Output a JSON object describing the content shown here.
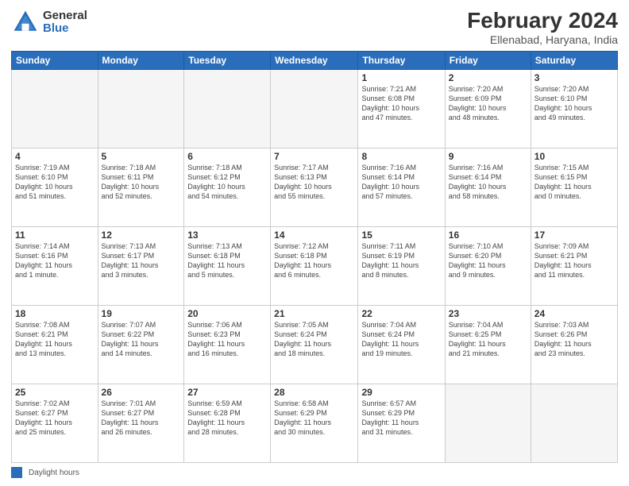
{
  "header": {
    "logo_general": "General",
    "logo_blue": "Blue",
    "main_title": "February 2024",
    "subtitle": "Ellenabad, Haryana, India"
  },
  "days_of_week": [
    "Sunday",
    "Monday",
    "Tuesday",
    "Wednesday",
    "Thursday",
    "Friday",
    "Saturday"
  ],
  "weeks": [
    [
      {
        "day": "",
        "info": ""
      },
      {
        "day": "",
        "info": ""
      },
      {
        "day": "",
        "info": ""
      },
      {
        "day": "",
        "info": ""
      },
      {
        "day": "1",
        "info": "Sunrise: 7:21 AM\nSunset: 6:08 PM\nDaylight: 10 hours\nand 47 minutes."
      },
      {
        "day": "2",
        "info": "Sunrise: 7:20 AM\nSunset: 6:09 PM\nDaylight: 10 hours\nand 48 minutes."
      },
      {
        "day": "3",
        "info": "Sunrise: 7:20 AM\nSunset: 6:10 PM\nDaylight: 10 hours\nand 49 minutes."
      }
    ],
    [
      {
        "day": "4",
        "info": "Sunrise: 7:19 AM\nSunset: 6:10 PM\nDaylight: 10 hours\nand 51 minutes."
      },
      {
        "day": "5",
        "info": "Sunrise: 7:18 AM\nSunset: 6:11 PM\nDaylight: 10 hours\nand 52 minutes."
      },
      {
        "day": "6",
        "info": "Sunrise: 7:18 AM\nSunset: 6:12 PM\nDaylight: 10 hours\nand 54 minutes."
      },
      {
        "day": "7",
        "info": "Sunrise: 7:17 AM\nSunset: 6:13 PM\nDaylight: 10 hours\nand 55 minutes."
      },
      {
        "day": "8",
        "info": "Sunrise: 7:16 AM\nSunset: 6:14 PM\nDaylight: 10 hours\nand 57 minutes."
      },
      {
        "day": "9",
        "info": "Sunrise: 7:16 AM\nSunset: 6:14 PM\nDaylight: 10 hours\nand 58 minutes."
      },
      {
        "day": "10",
        "info": "Sunrise: 7:15 AM\nSunset: 6:15 PM\nDaylight: 11 hours\nand 0 minutes."
      }
    ],
    [
      {
        "day": "11",
        "info": "Sunrise: 7:14 AM\nSunset: 6:16 PM\nDaylight: 11 hours\nand 1 minute."
      },
      {
        "day": "12",
        "info": "Sunrise: 7:13 AM\nSunset: 6:17 PM\nDaylight: 11 hours\nand 3 minutes."
      },
      {
        "day": "13",
        "info": "Sunrise: 7:13 AM\nSunset: 6:18 PM\nDaylight: 11 hours\nand 5 minutes."
      },
      {
        "day": "14",
        "info": "Sunrise: 7:12 AM\nSunset: 6:18 PM\nDaylight: 11 hours\nand 6 minutes."
      },
      {
        "day": "15",
        "info": "Sunrise: 7:11 AM\nSunset: 6:19 PM\nDaylight: 11 hours\nand 8 minutes."
      },
      {
        "day": "16",
        "info": "Sunrise: 7:10 AM\nSunset: 6:20 PM\nDaylight: 11 hours\nand 9 minutes."
      },
      {
        "day": "17",
        "info": "Sunrise: 7:09 AM\nSunset: 6:21 PM\nDaylight: 11 hours\nand 11 minutes."
      }
    ],
    [
      {
        "day": "18",
        "info": "Sunrise: 7:08 AM\nSunset: 6:21 PM\nDaylight: 11 hours\nand 13 minutes."
      },
      {
        "day": "19",
        "info": "Sunrise: 7:07 AM\nSunset: 6:22 PM\nDaylight: 11 hours\nand 14 minutes."
      },
      {
        "day": "20",
        "info": "Sunrise: 7:06 AM\nSunset: 6:23 PM\nDaylight: 11 hours\nand 16 minutes."
      },
      {
        "day": "21",
        "info": "Sunrise: 7:05 AM\nSunset: 6:24 PM\nDaylight: 11 hours\nand 18 minutes."
      },
      {
        "day": "22",
        "info": "Sunrise: 7:04 AM\nSunset: 6:24 PM\nDaylight: 11 hours\nand 19 minutes."
      },
      {
        "day": "23",
        "info": "Sunrise: 7:04 AM\nSunset: 6:25 PM\nDaylight: 11 hours\nand 21 minutes."
      },
      {
        "day": "24",
        "info": "Sunrise: 7:03 AM\nSunset: 6:26 PM\nDaylight: 11 hours\nand 23 minutes."
      }
    ],
    [
      {
        "day": "25",
        "info": "Sunrise: 7:02 AM\nSunset: 6:27 PM\nDaylight: 11 hours\nand 25 minutes."
      },
      {
        "day": "26",
        "info": "Sunrise: 7:01 AM\nSunset: 6:27 PM\nDaylight: 11 hours\nand 26 minutes."
      },
      {
        "day": "27",
        "info": "Sunrise: 6:59 AM\nSunset: 6:28 PM\nDaylight: 11 hours\nand 28 minutes."
      },
      {
        "day": "28",
        "info": "Sunrise: 6:58 AM\nSunset: 6:29 PM\nDaylight: 11 hours\nand 30 minutes."
      },
      {
        "day": "29",
        "info": "Sunrise: 6:57 AM\nSunset: 6:29 PM\nDaylight: 11 hours\nand 31 minutes."
      },
      {
        "day": "",
        "info": ""
      },
      {
        "day": "",
        "info": ""
      }
    ]
  ],
  "footer": {
    "swatch_label": "Daylight hours"
  }
}
